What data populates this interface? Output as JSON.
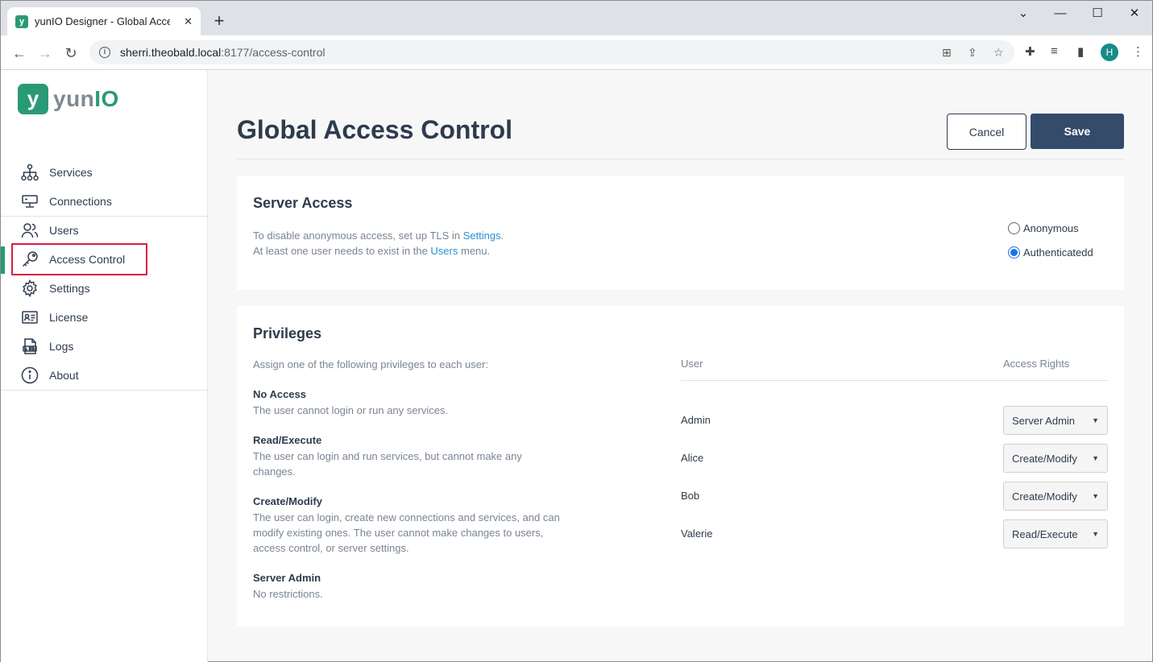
{
  "browser": {
    "tab_title": "yunIO Designer - Global Access Control",
    "tab_favicon": "y",
    "url_host": "sherri.theobald.local",
    "url_rest": ":8177/access-control",
    "profile_initial": "H"
  },
  "sidebar": {
    "logo_mark": "y",
    "logo_yun": "yun",
    "logo_io": "IO",
    "items": [
      {
        "label": "Services",
        "icon": "sitemap-icon"
      },
      {
        "label": "Connections",
        "icon": "monitor-icon"
      },
      {
        "label": "Users",
        "icon": "users-icon"
      },
      {
        "label": "Access Control",
        "icon": "key-icon"
      },
      {
        "label": "Settings",
        "icon": "gear-icon"
      },
      {
        "label": "License",
        "icon": "id-card-icon"
      },
      {
        "label": "Logs",
        "icon": "logs-icon"
      },
      {
        "label": "About",
        "icon": "info-icon"
      }
    ],
    "active_item": "Access Control"
  },
  "header": {
    "title": "Global Access Control",
    "cancel_label": "Cancel",
    "save_label": "Save"
  },
  "server_access": {
    "title": "Server Access",
    "line1_prefix": "To disable anonymous access, set up TLS in ",
    "line1_link": "Settings",
    "line1_suffix": ".",
    "line2_prefix": "At least one user needs to exist in the ",
    "line2_link": "Users",
    "line2_suffix": " menu.",
    "options": [
      {
        "label": "Anonymous",
        "selected": false
      },
      {
        "label": "Authenticatedd",
        "selected": true
      }
    ]
  },
  "privileges": {
    "title": "Privileges",
    "intro": "Assign one of the following privileges to each user:",
    "items": [
      {
        "name": "No Access",
        "desc": "The user cannot login or run any services."
      },
      {
        "name": "Read/Execute",
        "desc": "The user can login and run services, but cannot make any changes."
      },
      {
        "name": "Create/Modify",
        "desc": "The user can login, create new connections and services, and can modify existing ones. The user cannot make changes to users, access control, or server settings."
      },
      {
        "name": "Server Admin",
        "desc": "No restrictions."
      }
    ],
    "col_user": "User",
    "col_rights": "Access Rights",
    "users": [
      {
        "name": "Admin",
        "rights": "Server Admin"
      },
      {
        "name": "Alice",
        "rights": "Create/Modify"
      },
      {
        "name": "Bob",
        "rights": "Create/Modify"
      },
      {
        "name": "Valerie",
        "rights": "Read/Execute"
      }
    ]
  },
  "colors": {
    "brand": "#2a9a76",
    "primary": "#344b6b",
    "link": "#2a8fd2",
    "highlight": "#d81b44"
  }
}
